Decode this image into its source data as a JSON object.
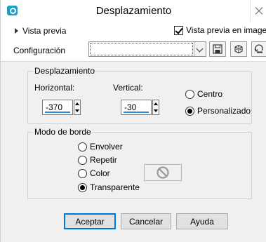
{
  "window": {
    "title": "Desplazamiento"
  },
  "preview": {
    "label": "Vista previa",
    "image_preview_label": "Vista previa en imagen",
    "image_preview_checked": true
  },
  "config": {
    "label": "Configuración",
    "preset_value": ""
  },
  "toolbar": {
    "icons": [
      "save-preset-icon",
      "random-icon",
      "reset-icon"
    ]
  },
  "offset": {
    "group_title": "Desplazamiento",
    "horizontal_label": "Horizontal:",
    "horizontal_value": "-370",
    "vertical_label": "Vertical:",
    "vertical_value": "-30",
    "options": [
      {
        "label": "Centro",
        "selected": false
      },
      {
        "label": "Personalizado",
        "selected": true
      }
    ]
  },
  "edge_mode": {
    "group_title": "Modo de borde",
    "options": [
      {
        "label": "Envolver",
        "selected": false
      },
      {
        "label": "Repetir",
        "selected": false
      },
      {
        "label": "Color",
        "selected": false
      },
      {
        "label": "Transparente",
        "selected": true
      }
    ]
  },
  "buttons": {
    "ok": "Aceptar",
    "cancel": "Cancelar",
    "help": "Ayuda"
  },
  "colors": {
    "accent": "#0078d7",
    "app_icon": "#1b9fc7",
    "spin_underline": "#2a8bd6"
  }
}
